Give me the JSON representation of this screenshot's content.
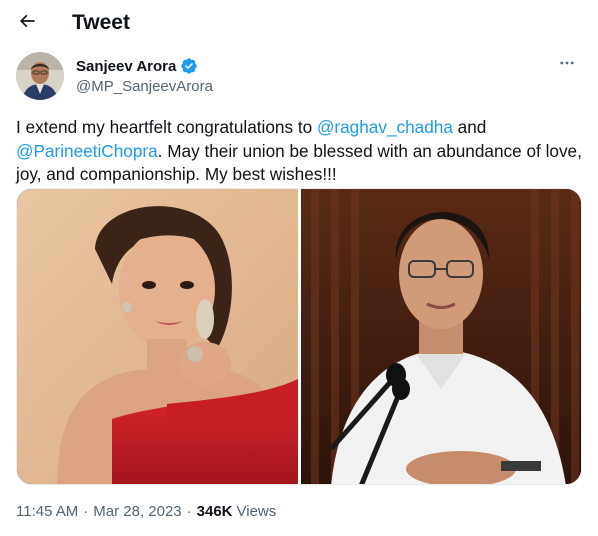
{
  "header": {
    "back_icon": "arrow-left-icon",
    "title": "Tweet"
  },
  "author": {
    "name": "Sanjeev Arora",
    "handle": "@MP_SanjeevArora",
    "verified_icon": "verified-badge-icon",
    "verified_color": "#1d9bf0",
    "more_icon": "more-horizontal-icon"
  },
  "tweet": {
    "text_part1": "I extend my heartfelt congratulations to ",
    "mention1": "@raghav_chadha",
    "text_part2": " and ",
    "mention2": "@ParineetiChopra",
    "text_part3": ". May their union be blessed with an abundance of love, joy, and companionship. My best wishes!!!"
  },
  "meta": {
    "time": "11:45 AM",
    "separator": "·",
    "date": "Mar 28, 2023",
    "views_count": "346K",
    "views_label": "Views"
  },
  "colors": {
    "accent": "#1d9bf0",
    "text": "#0f1419",
    "secondary": "#536471"
  }
}
